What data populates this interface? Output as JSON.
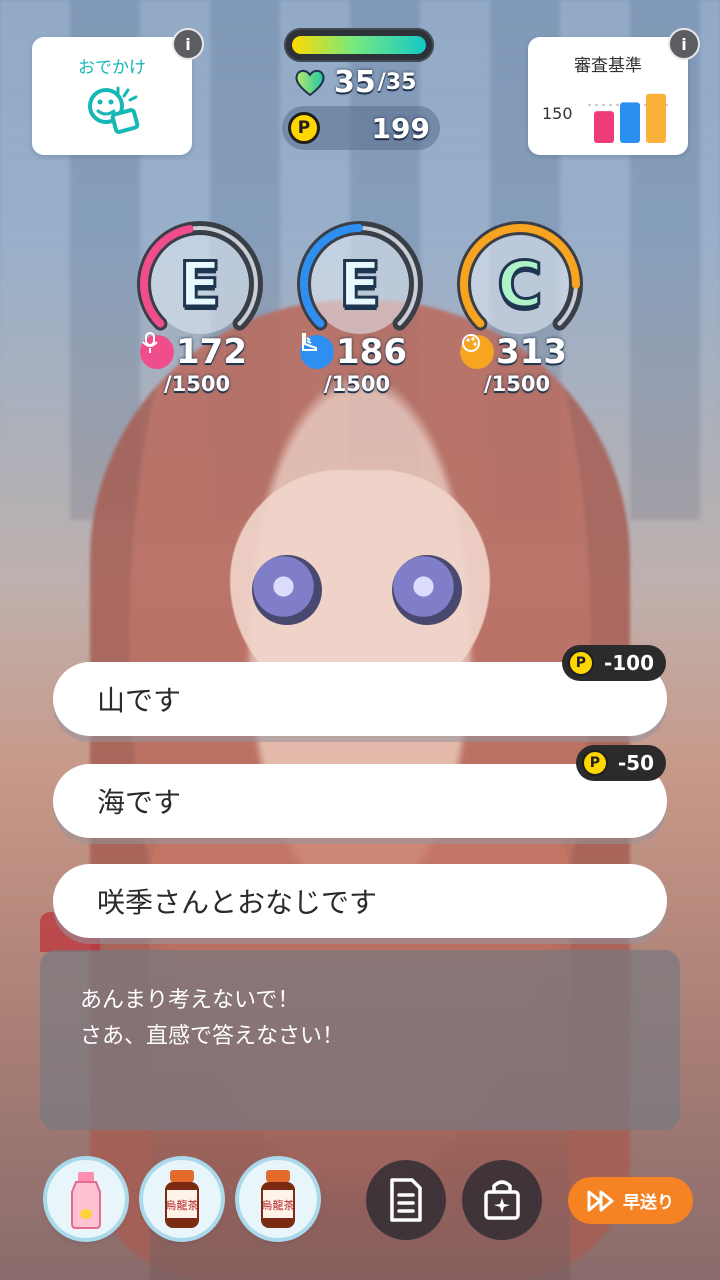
{
  "outing": {
    "label": "おでかけ",
    "icon": "smiley-note-icon"
  },
  "criteria": {
    "label": "審査基準",
    "threshold": "150",
    "bars": [
      {
        "color": "#ee3b7a",
        "value": 0.55
      },
      {
        "color": "#2a8ff0",
        "value": 0.7
      },
      {
        "color": "#fbb03b",
        "value": 0.85
      }
    ]
  },
  "stamina": {
    "current": "35",
    "max": "/35",
    "fill": 1.0
  },
  "points": {
    "value": "199",
    "coin_label": "P"
  },
  "stats": [
    {
      "rank": "E",
      "value": "172",
      "max": "/1500",
      "color": "#ef4d8b",
      "icon": "vocal-mic-icon",
      "progress": 0.115
    },
    {
      "rank": "E",
      "value": "186",
      "max": "/1500",
      "color": "#2e8ff0",
      "icon": "dance-shoe-icon",
      "progress": 0.124
    },
    {
      "rank": "C",
      "value": "313",
      "max": "/1500",
      "color": "#f7a420",
      "icon": "visual-palette-icon",
      "progress": 0.209
    }
  ],
  "choices": [
    {
      "text": "山です",
      "cost": "-100"
    },
    {
      "text": "海です",
      "cost": "-50"
    },
    {
      "text": "咲季さんとおなじです",
      "cost": ""
    }
  ],
  "dialog": {
    "line1": "あんまり考えないで！",
    "line2": "さあ、直感で答えなさい！"
  },
  "bottom": {
    "items": [
      "strawberry-milk-bottle-icon",
      "oolong-tea-bottle-icon",
      "oolong-tea-bottle-icon"
    ],
    "item_text": "烏龍茶",
    "log_icon": "document-icon",
    "bag_icon": "bag-sparkle-icon",
    "fast_forward": "早送り"
  }
}
